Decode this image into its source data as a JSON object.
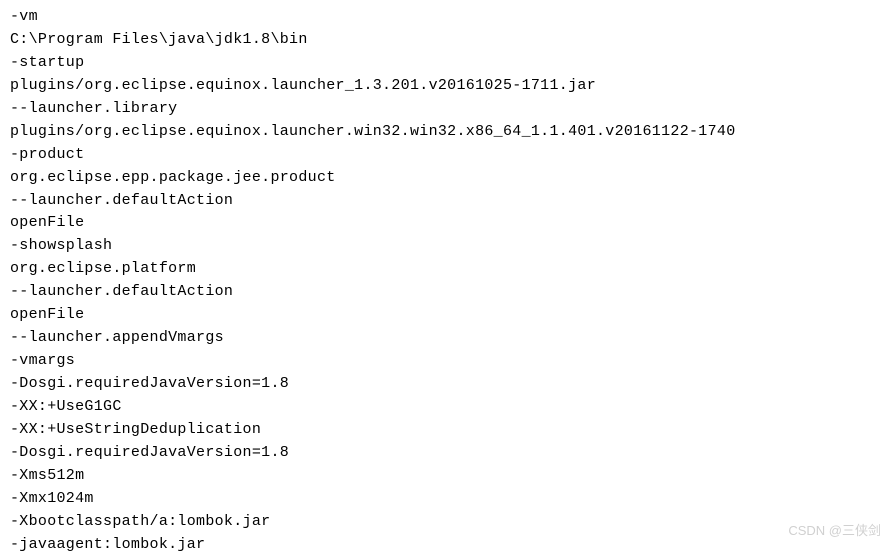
{
  "config": {
    "lines": [
      "-vm",
      "C:\\Program Files\\java\\jdk1.8\\bin",
      "-startup",
      "plugins/org.eclipse.equinox.launcher_1.3.201.v20161025-1711.jar",
      "--launcher.library",
      "plugins/org.eclipse.equinox.launcher.win32.win32.x86_64_1.1.401.v20161122-1740",
      "-product",
      "org.eclipse.epp.package.jee.product",
      "--launcher.defaultAction",
      "openFile",
      "-showsplash",
      "org.eclipse.platform",
      "--launcher.defaultAction",
      "openFile",
      "--launcher.appendVmargs",
      "-vmargs",
      "-Dosgi.requiredJavaVersion=1.8",
      "-XX:+UseG1GC",
      "-XX:+UseStringDeduplication",
      "-Dosgi.requiredJavaVersion=1.8",
      "-Xms512m",
      "-Xmx1024m",
      "-Xbootclasspath/a:lombok.jar",
      "-javaagent:lombok.jar"
    ]
  },
  "watermark": {
    "text": "CSDN @三侠剑"
  }
}
